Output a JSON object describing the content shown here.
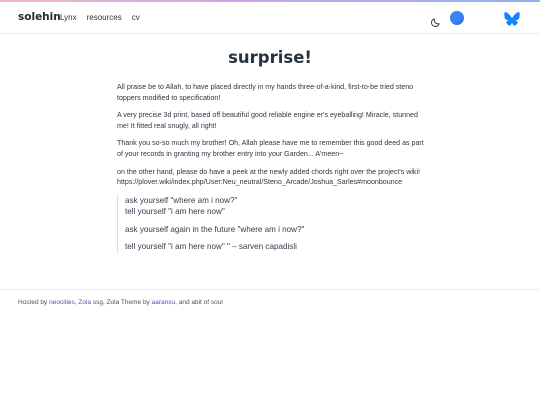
{
  "nav": {
    "brand": "solehin",
    "links": [
      "Lynx",
      "resources",
      "cv"
    ]
  },
  "icons": {
    "theme_toggle": "moon-icon",
    "avatar": "circle-avatar-icon",
    "social": "bluesky-butterfly-icon"
  },
  "colors": {
    "accent_blue": "#3b82f6",
    "link": "#4a56b0",
    "text": "#2e3742"
  },
  "article": {
    "title": "surprise!",
    "paragraphs": [
      "All praise be to Allah, to have placed directly in my hands three-of-a-kind, first-to-be tried steno toppers modified to specification!",
      "A very precise 3d print, based off beautiful good reliable engine er's eyeballing! Miracle, stunned me! It fitted real snugly, all right!",
      "Thank you so-so much my brother! Oh, Allah please have me to remember this good deed as part of your records in granting my brother entry into your Garden... A'meen~",
      "on the other hand, please do have a peek at the newly added chords right over the project's wiki! https://plover.wiki/index.php/User:Neu_neutral/Steno_Arcade/Joshua_Sarles#moonbounce"
    ],
    "quote": {
      "line1": "ask yourself \"where am i now?\"",
      "line2": "tell yourself \"i am here now\"",
      "line3": "ask yourself again in the future \"where am i now?\"",
      "line4": "tell yourself \"i am here now\" \" – sarven capadisli"
    }
  },
  "footer": {
    "hosted_by": "Hosted by",
    "host": "neocities",
    "sep1": ",",
    "zola": "Zola",
    "ssg": "ssg,",
    "theme_prefix": "Zola Theme by",
    "theme_author": "aaranxu",
    "suffix": ", and abit of soul"
  }
}
